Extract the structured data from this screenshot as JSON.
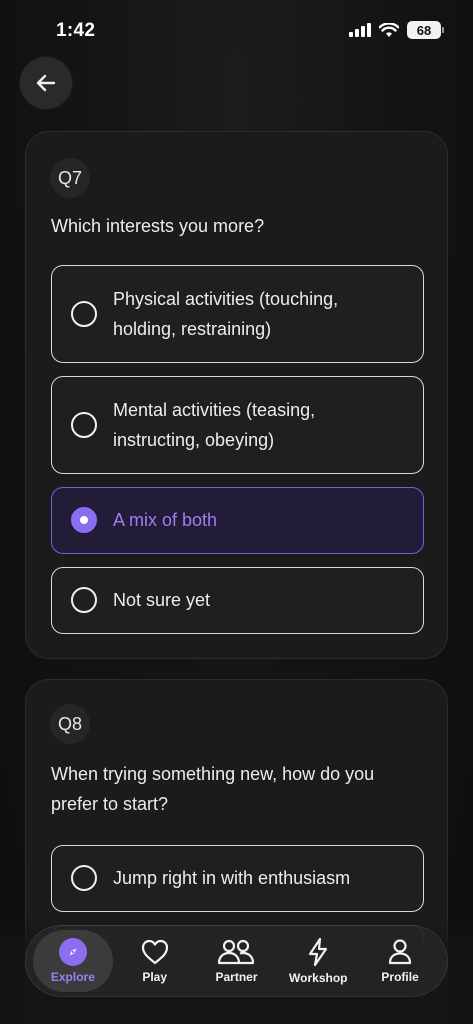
{
  "status_bar": {
    "time": "1:42",
    "battery": "68"
  },
  "header": {
    "back_icon": "arrow-left-icon"
  },
  "questions": [
    {
      "badge": "Q7",
      "text": "Which interests you more?",
      "options": [
        {
          "label": "Physical activities (touching, holding, restraining)",
          "selected": false
        },
        {
          "label": "Mental activities (teasing, instructing, obeying)",
          "selected": false
        },
        {
          "label": "A mix of both",
          "selected": true
        },
        {
          "label": "Not sure yet",
          "selected": false
        }
      ]
    },
    {
      "badge": "Q8",
      "text": "When trying something new, how do you prefer to start?",
      "options": [
        {
          "label": "Jump right in with enthusiasm",
          "selected": false
        }
      ]
    }
  ],
  "bottom_nav": {
    "items": [
      {
        "label": "Explore",
        "icon": "compass-icon",
        "active": true
      },
      {
        "label": "Play",
        "icon": "heart-icon",
        "active": false
      },
      {
        "label": "Partner",
        "icon": "partner-icon",
        "active": false
      },
      {
        "label": "Workshop",
        "icon": "lightning-icon",
        "active": false
      },
      {
        "label": "Profile",
        "icon": "profile-icon",
        "active": false
      }
    ]
  },
  "colors": {
    "accent": "#8b6ef0",
    "background": "#141414",
    "card": "#1b1b1b"
  }
}
